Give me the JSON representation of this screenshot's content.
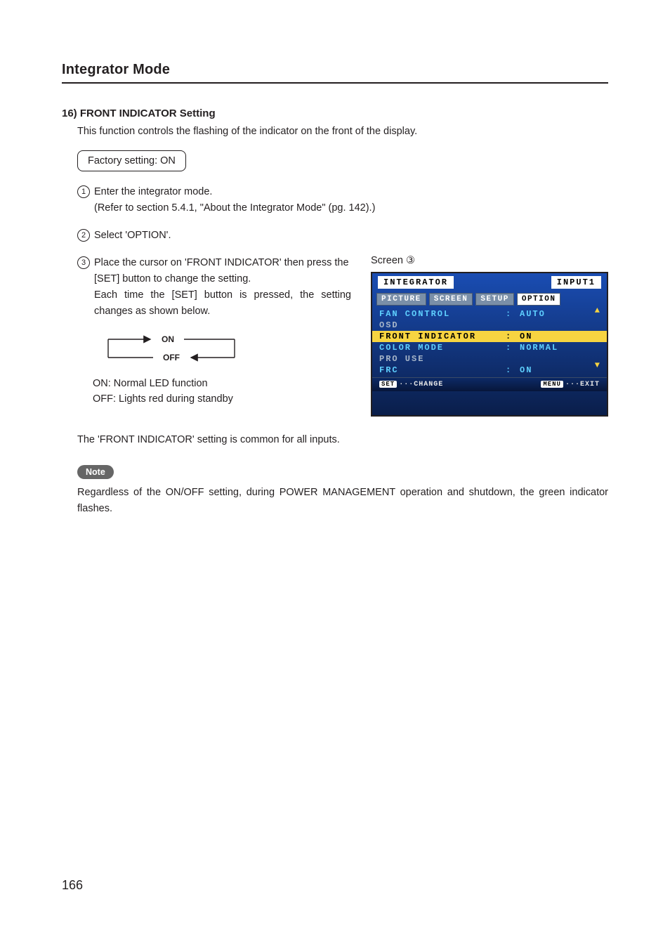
{
  "page": {
    "section_title": "Integrator Mode",
    "page_number": "166"
  },
  "heading": {
    "num": "16)",
    "title": "FRONT INDICATOR Setting"
  },
  "intro": "This function controls the flashing of the indicator on the front of the display.",
  "factory_box": "Factory setting: ON",
  "steps": {
    "s1_line1": "Enter the integrator mode.",
    "s1_line2": "(Refer to section 5.4.1, \"About the Integrator Mode\" (pg. 142).)",
    "s2": "Select 'OPTION'.",
    "s3_line1": "Place the cursor on 'FRONT INDICATOR' then press the [SET] button to change the setting.",
    "s3_line2": "Each time the [SET] button is pressed, the setting changes as shown below."
  },
  "cycle": {
    "on": "ON",
    "off": "OFF"
  },
  "legend": {
    "on": "ON:  Normal LED function",
    "off": "OFF:  Lights red during standby"
  },
  "common_line": "The 'FRONT INDICATOR' setting is common for all inputs.",
  "note": {
    "label": "Note",
    "text": "Regardless of the ON/OFF setting, during POWER MANAGEMENT operation and shutdown, the green indicator flashes."
  },
  "screen_label": "Screen ③",
  "osd": {
    "title": "INTEGRATOR",
    "input": "INPUT1",
    "tabs": [
      "PICTURE",
      "SCREEN",
      "SETUP",
      "OPTION"
    ],
    "active_tab": "OPTION",
    "rows": [
      {
        "k": "FAN CONTROL",
        "v": "AUTO",
        "colon": true,
        "cls": "active"
      },
      {
        "k": "OSD",
        "v": "",
        "colon": false,
        "cls": ""
      },
      {
        "k": "FRONT INDICATOR",
        "v": "ON",
        "colon": true,
        "cls": "hl"
      },
      {
        "k": "COLOR MODE",
        "v": "NORMAL",
        "colon": true,
        "cls": "active"
      },
      {
        "k": "PRO USE",
        "v": "",
        "colon": false,
        "cls": ""
      },
      {
        "k": "FRC",
        "v": "ON",
        "colon": true,
        "cls": "active"
      }
    ],
    "footer": {
      "set": "SET",
      "change": "CHANGE",
      "menu": "MENU",
      "exit": "EXIT"
    }
  }
}
